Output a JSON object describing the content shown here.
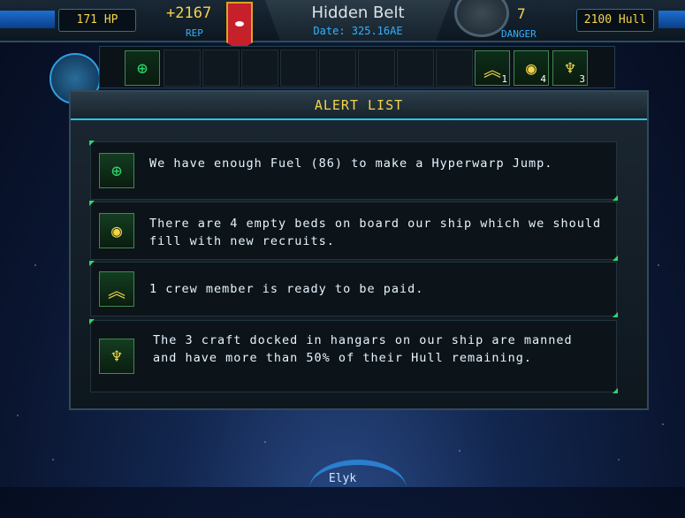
{
  "hud": {
    "hp": "171 HP",
    "rep_value": "+2167",
    "rep_label": "REP",
    "location": "Hidden Belt",
    "date": "Date: 325.16AE",
    "danger_value": "7",
    "danger_label": "DANGER",
    "hull": "2100 Hull"
  },
  "slots": {
    "left_icon": "hyperwarp-icon",
    "right_icons": [
      {
        "icon": "rank-chevron-icon",
        "count": "1"
      },
      {
        "icon": "crew-helmet-icon",
        "count": "4"
      },
      {
        "icon": "craft-shield-icon",
        "count": "3"
      }
    ]
  },
  "panel": {
    "title": "ALERT LIST",
    "alerts": [
      {
        "icon": "hyperwarp-icon",
        "text": "We have enough Fuel (86) to make a Hyperwarp Jump."
      },
      {
        "icon": "crew-helmet-icon",
        "text": "There are 4 empty beds on board our ship which we should fill with new recruits."
      },
      {
        "icon": "rank-chevron-icon",
        "text": "1 crew member is ready to be paid."
      },
      {
        "icon": "craft-shield-icon",
        "text": "The 3 craft docked in hangars on our ship are manned and have more than 50% of their Hull remaining."
      }
    ]
  },
  "player_name": "Elyk",
  "colors": {
    "accent_yellow": "#f4d44a",
    "accent_cyan": "#2fb2ff",
    "accent_green": "#2fd66a"
  }
}
